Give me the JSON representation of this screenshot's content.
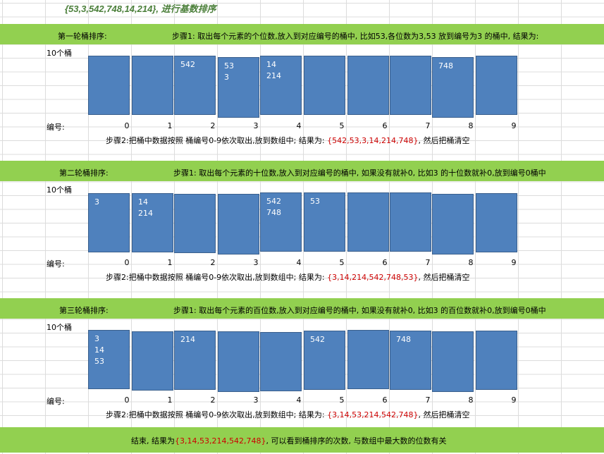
{
  "title": "{53,3,542,748,14,214}, 进行基数排序",
  "bucket_count_label": "10个桶",
  "index_label": "编号:",
  "bucket_numbers": [
    "0",
    "1",
    "2",
    "3",
    "4",
    "5",
    "6",
    "7",
    "8",
    "9"
  ],
  "rounds": [
    {
      "heading": "第一轮桶排序:",
      "step1": "步骤1: 取出每个元素的个位数,放入到对应编号的桶中,     比如53,各位数为3,53 放到编号为3 的桶中, 结果为:",
      "buckets": [
        [],
        [],
        [
          "542"
        ],
        [
          "53",
          "3"
        ],
        [
          "14",
          "214"
        ],
        [],
        [],
        [],
        [
          "748"
        ],
        []
      ],
      "step2_prefix": "步骤2:把桶中数据按照 桶编号0-9依次取出,放到数组中; 结果为: ",
      "step2_result": "{542,53,3,14,214,748}",
      "step2_suffix": ", 然后把桶清空"
    },
    {
      "heading": "第二轮桶排序:",
      "step1": "步骤1: 取出每个元素的十位数,放入到对应编号的桶中, 如果没有就补0, 比如3 的十位数就补0,放到编号0桶中",
      "buckets": [
        [
          "3"
        ],
        [
          "14",
          "214"
        ],
        [],
        [],
        [
          "542",
          "748"
        ],
        [
          "53"
        ],
        [],
        [],
        [],
        []
      ],
      "step2_prefix": "步骤2:把桶中数据按照 桶编号0-9依次取出,放到数组中; 结果为: ",
      "step2_result": "{3,14,214,542,748,53}",
      "step2_suffix": ", 然后把桶清空"
    },
    {
      "heading": "第三轮桶排序:",
      "step1": "步骤1: 取出每个元素的百位数,放入到对应编号的桶中, 如果没有就补0, 比如3 的百位数就补0,放到编号0桶中",
      "buckets": [
        [
          "3",
          "14",
          "53"
        ],
        [],
        [
          "214"
        ],
        [],
        [],
        [
          "542"
        ],
        [],
        [
          "748"
        ],
        [],
        []
      ],
      "step2_prefix": "步骤2:把桶中数据按照 桶编号0-9依次取出,放到数组中; 结果为: ",
      "step2_result": "{3,14,53,214,542,748}",
      "step2_suffix": ", 然后把桶清空"
    }
  ],
  "conclusion_prefix": "结束, 结果为",
  "conclusion_result": "{3,14,53,214,542,748}",
  "conclusion_suffix": ",    可以看到桶排序的次数, 与数组中最大数的位数有关",
  "colors": {
    "band": "#92d050",
    "bucket": "#4f81bd",
    "highlight": "#cc0000",
    "title": "#4b7f3a"
  }
}
